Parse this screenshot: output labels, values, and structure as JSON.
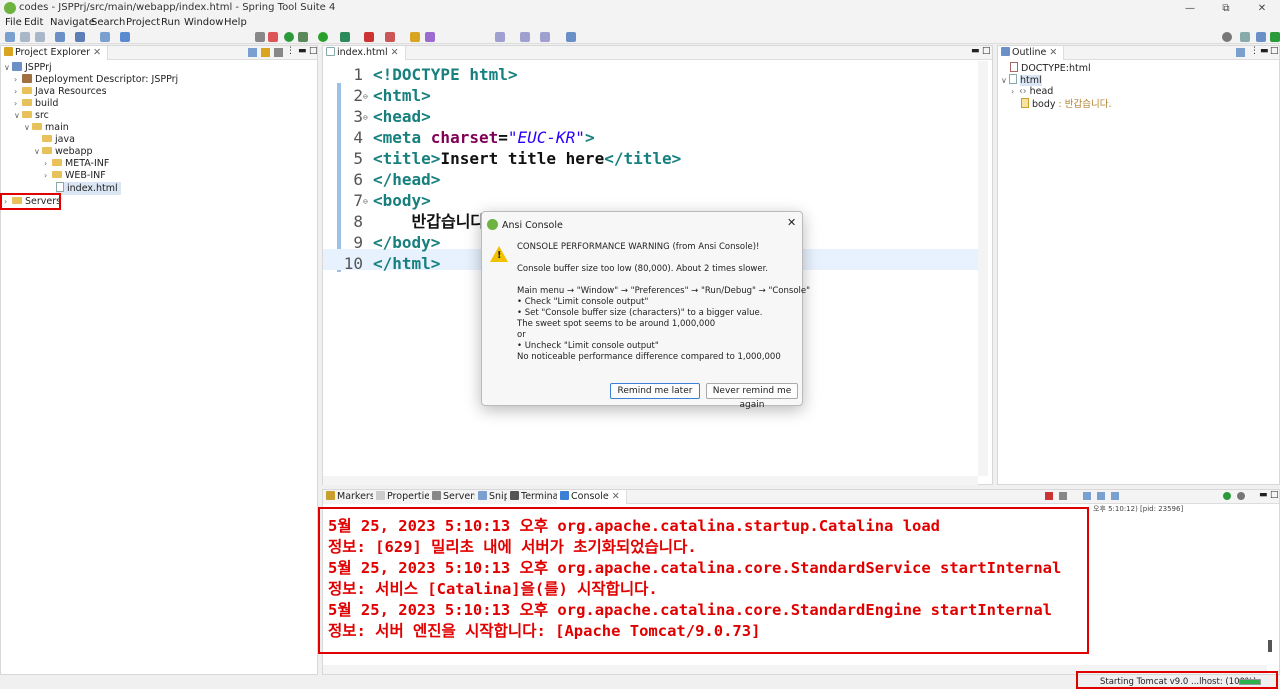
{
  "window": {
    "title": "codes - JSPPrj/src/main/webapp/index.html - Spring Tool Suite 4",
    "controls": [
      "—",
      "⧉",
      "✕"
    ]
  },
  "menu": [
    "File",
    "Edit",
    "Navigate",
    "Search",
    "Project",
    "Run",
    "Window",
    "Help"
  ],
  "project_explorer": {
    "tab_label": "Project Explorer",
    "items": [
      {
        "label": "JSPPrj",
        "arrow": "∨",
        "icon": "project-icon"
      },
      {
        "label": "Deployment Descriptor: JSPPrj",
        "arrow": "›",
        "icon": "descriptor-icon"
      },
      {
        "label": "Java Resources",
        "arrow": "›",
        "icon": "java-resources-icon"
      },
      {
        "label": "build",
        "arrow": "›",
        "icon": "folder-icon"
      },
      {
        "label": "src",
        "arrow": "∨",
        "icon": "folder-icon"
      },
      {
        "label": "main",
        "arrow": "∨",
        "icon": "folder-icon"
      },
      {
        "label": "java",
        "arrow": "",
        "icon": "folder-icon"
      },
      {
        "label": "webapp",
        "arrow": "∨",
        "icon": "folder-icon"
      },
      {
        "label": "META-INF",
        "arrow": "›",
        "icon": "folder-icon"
      },
      {
        "label": "WEB-INF",
        "arrow": "›",
        "icon": "folder-icon"
      },
      {
        "label": "index.html",
        "arrow": "",
        "icon": "file-icon"
      },
      {
        "label": "Servers",
        "arrow": "›",
        "icon": "folder-icon"
      }
    ]
  },
  "editor": {
    "tab_label": "index.html",
    "lines": [
      {
        "n": "1",
        "mark": "",
        "parts": [
          {
            "c": "tag",
            "t": "<!DOCTYPE html>"
          }
        ]
      },
      {
        "n": "2",
        "mark": "⊖",
        "parts": [
          {
            "c": "tag",
            "t": "<html>"
          }
        ]
      },
      {
        "n": "3",
        "mark": "⊖",
        "parts": [
          {
            "c": "tag",
            "t": "<head>"
          }
        ]
      },
      {
        "n": "4",
        "mark": "",
        "parts": [
          {
            "c": "tag",
            "t": "<meta "
          },
          {
            "c": "attr",
            "t": "charset"
          },
          {
            "c": "txt",
            "t": "="
          },
          {
            "c": "val",
            "t": "\"EUC-KR\""
          },
          {
            "c": "tag",
            "t": ">"
          }
        ]
      },
      {
        "n": "5",
        "mark": "",
        "parts": [
          {
            "c": "tag",
            "t": "<title>"
          },
          {
            "c": "txt",
            "t": "Insert title here"
          },
          {
            "c": "tag",
            "t": "</title>"
          }
        ]
      },
      {
        "n": "6",
        "mark": "",
        "parts": [
          {
            "c": "tag",
            "t": "</head>"
          }
        ]
      },
      {
        "n": "7",
        "mark": "⊖",
        "parts": [
          {
            "c": "tag",
            "t": "<body>"
          }
        ]
      },
      {
        "n": "8",
        "mark": "",
        "parts": [
          {
            "c": "txt",
            "t": "    반갑습니다."
          }
        ]
      },
      {
        "n": "9",
        "mark": "",
        "parts": [
          {
            "c": "tag",
            "t": "</body>"
          }
        ]
      },
      {
        "n": "10",
        "mark": "",
        "parts": [
          {
            "c": "tag",
            "t": "</html>"
          }
        ]
      }
    ]
  },
  "outline": {
    "tab_label": "Outline",
    "items": [
      {
        "label": "DOCTYPE:html"
      },
      {
        "label": "html"
      },
      {
        "label": "head"
      },
      {
        "label": "body",
        "suffix": " : 반갑습니다."
      }
    ]
  },
  "dialog": {
    "title": "Ansi Console",
    "lines": [
      "CONSOLE PERFORMANCE WARNING (from Ansi Console)!",
      "",
      "Console buffer size too low (80,000). About 2 times slower.",
      "",
      "Main menu → \"Window\" → \"Preferences\" → \"Run/Debug\" → \"Console\"",
      "    • Check \"Limit console output\"",
      "    • Set \"Console buffer size (characters)\" to a bigger value.",
      "      The sweet spot seems to be around 1,000,000",
      "or",
      "    • Uncheck \"Limit console output\"",
      "      No noticeable performance difference compared to 1,000,000"
    ],
    "btn_later": "Remind me later",
    "btn_never": "Never remind me again"
  },
  "bottom_tabs": [
    "Markers",
    "Properties",
    "Servers",
    "Snippets",
    "Terminal",
    "Console"
  ],
  "console": {
    "header_suffix": "오후 5:10:12) [pid: 23596]",
    "lines": [
      "5월 25, 2023 5:10:13 오후 org.apache.catalina.startup.Catalina load",
      "정보: [629] 밀리초 내에 서버가 초기화되었습니다.",
      "5월 25, 2023 5:10:13 오후 org.apache.catalina.core.StandardService startInternal",
      "정보: 서비스 [Catalina]을(를) 시작합니다.",
      "5월 25, 2023 5:10:13 오후 org.apache.catalina.core.StandardEngine startInternal",
      "정보: 서버 엔진을 시작합니다: [Apache Tomcat/9.0.73]"
    ]
  },
  "status": {
    "text": "Starting Tomcat v9.0 ...lhost: (100%)"
  },
  "colors": {
    "highlight": "#e00000",
    "tag": "#17807e",
    "attr": "#7f0055",
    "value": "#2a00ff"
  }
}
